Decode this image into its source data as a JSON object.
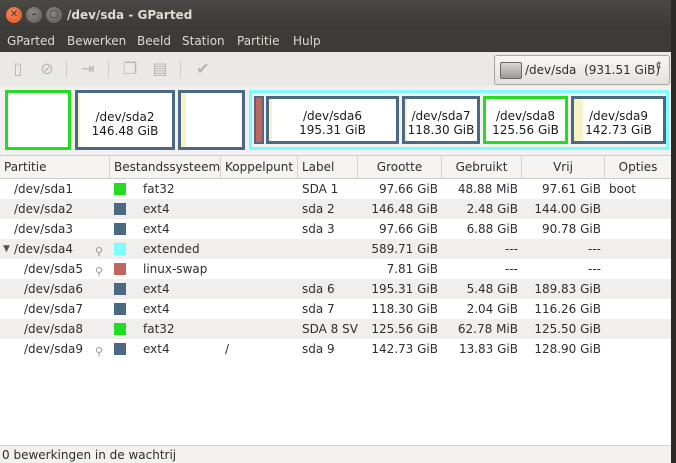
{
  "window": {
    "title": "/dev/sda - GParted"
  },
  "menu": [
    "GParted",
    "Bewerken",
    "Beeld",
    "Station",
    "Partitie",
    "Hulp"
  ],
  "device": {
    "name": "/dev/sda",
    "size": "(931.51 GiB)"
  },
  "map": [
    {
      "name": "",
      "size": ""
    },
    {
      "name": "/dev/sda2",
      "size": "146.48 GiB"
    },
    {
      "name": "",
      "size": ""
    },
    {
      "name": "/dev/sda6",
      "size": "195.31 GiB"
    },
    {
      "name": "/dev/sda7",
      "size": "118.30 GiB"
    },
    {
      "name": "/dev/sda8",
      "size": "125.56 GiB"
    },
    {
      "name": "/dev/sda9",
      "size": "142.73 GiB"
    }
  ],
  "colors": {
    "fat32": "#22dd22",
    "ext4": "#4b6983",
    "extended": "#7efcfc",
    "linux-swap": "#c1665a"
  },
  "columns": [
    "Partitie",
    "Bestandssysteem",
    "Koppelpunt",
    "Label",
    "Grootte",
    "Gebruikt",
    "Vrij",
    "Opties"
  ],
  "rows": [
    {
      "partition": "/dev/sda1",
      "fs": "fat32",
      "mount": "",
      "label": "SDA 1",
      "size": "97.66 GiB",
      "used": "48.88 MiB",
      "free": "97.61 GiB",
      "flags": "boot"
    },
    {
      "partition": "/dev/sda2",
      "fs": "ext4",
      "mount": "",
      "label": "sda 2",
      "size": "146.48 GiB",
      "used": "2.48 GiB",
      "free": "144.00 GiB",
      "flags": ""
    },
    {
      "partition": "/dev/sda3",
      "fs": "ext4",
      "mount": "",
      "label": "sda 3",
      "size": "97.66 GiB",
      "used": "6.88 GiB",
      "free": "90.78 GiB",
      "flags": ""
    },
    {
      "partition": "/dev/sda4",
      "fs": "extended",
      "mount": "",
      "label": "",
      "size": "589.71 GiB",
      "used": "---",
      "free": "---",
      "flags": ""
    },
    {
      "partition": "/dev/sda5",
      "fs": "linux-swap",
      "mount": "",
      "label": "",
      "size": "7.81 GiB",
      "used": "---",
      "free": "---",
      "flags": ""
    },
    {
      "partition": "/dev/sda6",
      "fs": "ext4",
      "mount": "",
      "label": "sda 6",
      "size": "195.31 GiB",
      "used": "5.48 GiB",
      "free": "189.83 GiB",
      "flags": ""
    },
    {
      "partition": "/dev/sda7",
      "fs": "ext4",
      "mount": "",
      "label": "sda 7",
      "size": "118.30 GiB",
      "used": "2.04 GiB",
      "free": "116.26 GiB",
      "flags": ""
    },
    {
      "partition": "/dev/sda8",
      "fs": "fat32",
      "mount": "",
      "label": "SDA 8 SV",
      "size": "125.56 GiB",
      "used": "62.78 MiB",
      "free": "125.50 GiB",
      "flags": ""
    },
    {
      "partition": "/dev/sda9",
      "fs": "ext4",
      "mount": "/",
      "label": "sda 9",
      "size": "142.73 GiB",
      "used": "13.83 GiB",
      "free": "128.90 GiB",
      "flags": ""
    }
  ],
  "status": "0 bewerkingen in de wachtrij"
}
